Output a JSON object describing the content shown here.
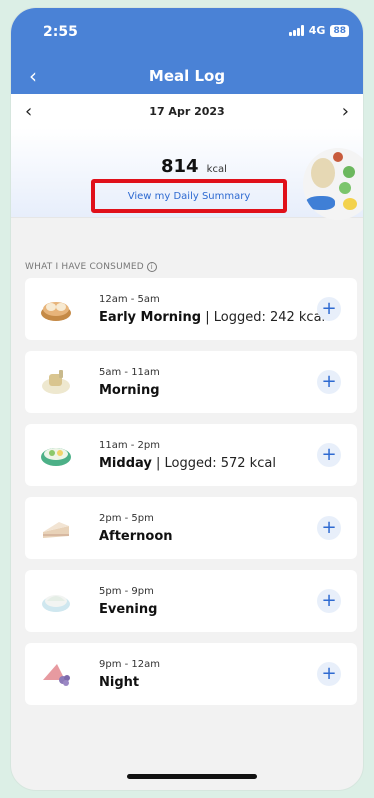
{
  "status": {
    "time": "2:55",
    "network": "4G",
    "battery": "88"
  },
  "header": {
    "title": "Meal Log"
  },
  "datebar": {
    "date": "17 Apr 2023"
  },
  "summary": {
    "kcal_value": "814",
    "kcal_unit": "kcal",
    "link": "View my Daily Summary"
  },
  "section": {
    "title": "WHAT I HAVE CONSUMED"
  },
  "meals": [
    {
      "time": "12am - 5am",
      "name": "Early Morning",
      "logged": " | Logged: 242 kcal",
      "icon": "dumpling-basket-icon"
    },
    {
      "time": "5am - 11am",
      "name": "Morning",
      "logged": "",
      "icon": "toast-icon"
    },
    {
      "time": "11am - 2pm",
      "name": "Midday",
      "logged": " | Logged: 572 kcal",
      "icon": "salad-bowl-icon"
    },
    {
      "time": "2pm - 5pm",
      "name": "Afternoon",
      "logged": "",
      "icon": "cake-slice-icon"
    },
    {
      "time": "5pm - 9pm",
      "name": "Evening",
      "logged": "",
      "icon": "pie-icon"
    },
    {
      "time": "9pm - 12am",
      "name": "Night",
      "logged": "",
      "icon": "fruit-icon"
    }
  ],
  "colors": {
    "brand": "#4a82d6",
    "link": "#2e6ad1",
    "highlight": "#e0101a"
  }
}
